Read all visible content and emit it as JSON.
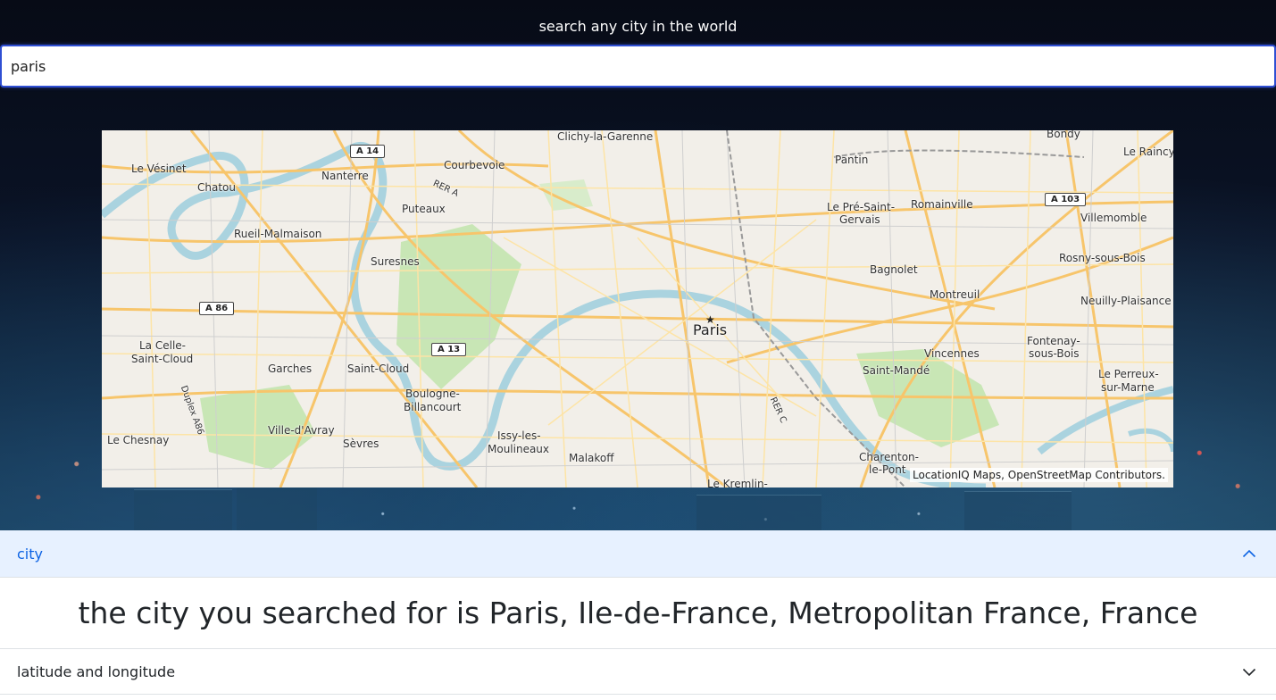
{
  "header": {
    "title": "search any city in the world"
  },
  "search": {
    "value": "paris"
  },
  "map": {
    "center_city": "Paris",
    "places": [
      "Clichy-la-Garenne",
      "Bondy",
      "Le Raincy",
      "Le Vésinet",
      "Nanterre",
      "Courbevoie",
      "Pantin",
      "Chatou",
      "Le Pré-Saint-",
      "Gervais",
      "Romainville",
      "Villemomble",
      "Puteaux",
      "Rueil-Malmaison",
      "Suresnes",
      "Bagnolet",
      "Rosny-sous-Bois",
      "Montreuil",
      "Neuilly-Plaisance",
      "La Celle-",
      "Saint-Cloud",
      "Garches",
      "Saint-Cloud",
      "Vincennes",
      "Fontenay-",
      "sous-Bois",
      "Saint-Mandé",
      "Le Perreux-",
      "sur-Marne",
      "Boulogne-",
      "Billancourt",
      "Le Chesnay",
      "Ville-d'Avray",
      "Sèvres",
      "Issy-les-",
      "Moulineaux",
      "Malakoff",
      "Charenton-",
      "le-Pont",
      "Le Kremlin-"
    ],
    "roads": [
      "A 14",
      "A 103",
      "A 86",
      "A 13",
      "RER A",
      "RER C",
      "Duplex A86"
    ],
    "attribution": "LocationIQ Maps, OpenStreetMap Contributors."
  },
  "accordion": {
    "city": {
      "label": "city",
      "expanded": true,
      "body": "the city you searched for is Paris, Ile-de-France, Metropolitan France, France"
    },
    "latlng": {
      "label": "latitude and longitude",
      "expanded": false
    }
  },
  "colors": {
    "accent": "#0c63e4",
    "accordion_active_bg": "#e7f1ff",
    "input_border": "#2f4fd3"
  }
}
